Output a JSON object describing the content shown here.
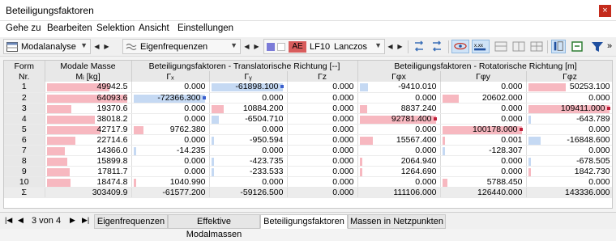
{
  "window": {
    "title": "Beteiligungsfaktoren",
    "close_glyph": "×"
  },
  "menu": [
    "Gehe zu",
    "Bearbeiten",
    "Selektion",
    "Ansicht",
    "Einstellungen"
  ],
  "toolbar": {
    "analysis": "Modalanalyse",
    "result": "Eigenfrequenzen",
    "ae_badge": "AE",
    "load_case": "LF10",
    "solver": "Lanczos",
    "more": "»"
  },
  "table": {
    "col_form": "Form",
    "col_nr": "Nr.",
    "col_mass": "Modale Masse",
    "col_mass_unit": "Mᵢ [kg]",
    "group_trans": "Beteiligungsfaktoren - Translatorische Richtung [--]",
    "group_rot": "Beteiligungsfaktoren - Rotatorische Richtung [m]",
    "h_gx": "Γₓ",
    "h_gy": "Γᵧ",
    "h_gz": "Γz",
    "h_gpx": "Γφx",
    "h_gpy": "Γφy",
    "h_gpz": "Γφz",
    "rows": [
      {
        "nr": "1",
        "m": "49942.5",
        "gx": "0.000",
        "gy": "-61898.100",
        "gz": "0.000",
        "px": "-9410.010",
        "py": "0.000",
        "pz": "50253.100"
      },
      {
        "nr": "2",
        "m": "64093.6",
        "gx": "-72366.300",
        "gy": "0.000",
        "gz": "0.000",
        "px": "0.000",
        "py": "20602.000",
        "pz": "0.000"
      },
      {
        "nr": "3",
        "m": "19370.6",
        "gx": "0.000",
        "gy": "10884.200",
        "gz": "0.000",
        "px": "8837.240",
        "py": "0.000",
        "pz": "109411.000"
      },
      {
        "nr": "4",
        "m": "38018.2",
        "gx": "0.000",
        "gy": "-6504.710",
        "gz": "0.000",
        "px": "92781.400",
        "py": "0.000",
        "pz": "-643.789"
      },
      {
        "nr": "5",
        "m": "42717.9",
        "gx": "9762.380",
        "gy": "0.000",
        "gz": "0.000",
        "px": "0.000",
        "py": "100178.000",
        "pz": "0.000"
      },
      {
        "nr": "6",
        "m": "22714.6",
        "gx": "0.000",
        "gy": "-950.594",
        "gz": "0.000",
        "px": "15567.400",
        "py": "0.001",
        "pz": "-16848.600"
      },
      {
        "nr": "7",
        "m": "14366.0",
        "gx": "-14.235",
        "gy": "0.000",
        "gz": "0.000",
        "px": "0.000",
        "py": "-128.307",
        "pz": "0.000"
      },
      {
        "nr": "8",
        "m": "15899.8",
        "gx": "0.000",
        "gy": "-423.735",
        "gz": "0.000",
        "px": "2064.940",
        "py": "0.000",
        "pz": "-678.505"
      },
      {
        "nr": "9",
        "m": "17811.7",
        "gx": "0.000",
        "gy": "-233.533",
        "gz": "0.000",
        "px": "1264.690",
        "py": "0.000",
        "pz": "1842.730"
      },
      {
        "nr": "10",
        "m": "18474.8",
        "gx": "1040.990",
        "gy": "0.000",
        "gz": "0.000",
        "px": "0.000",
        "py": "5788.450",
        "pz": "0.000"
      }
    ],
    "sum": {
      "nr": "Σ",
      "m": "303409.9",
      "gx": "-61577.200",
      "gy": "-59126.500",
      "gz": "0.000",
      "px": "111106.000",
      "py": "126440.000",
      "pz": "143336.000"
    }
  },
  "bottom": {
    "page": "3 von 4",
    "tabs": [
      "Eigenfrequenzen",
      "Effektive Modalmassen",
      "Beteiligungsfaktoren",
      "Massen in Netzpunkten"
    ]
  },
  "colors": {
    "bar_positive": "#f7b8c0",
    "bar_negative": "#c5d9f3",
    "marker_red": "#c0203a",
    "marker_blue": "#3a5fcd",
    "close": "#c42b1c"
  }
}
